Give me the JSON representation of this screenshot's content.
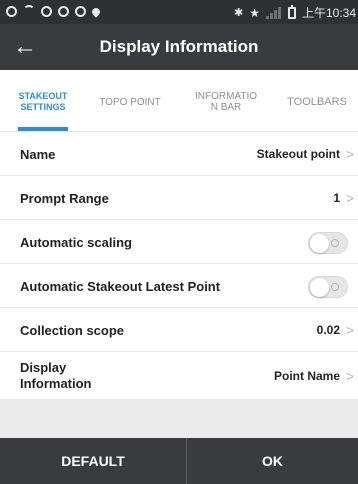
{
  "status_bar": {
    "time": "上午10:34",
    "icons": [
      "circle-icon",
      "wifi-icon",
      "circle-icon",
      "circle-icon",
      "settings-icon",
      "pin-icon",
      "bluetooth-icon",
      "star-icon",
      "signal-icon",
      "battery-icon"
    ]
  },
  "header": {
    "title": "Display Information",
    "back_icon": "arrow-left-icon"
  },
  "tabs": [
    {
      "label": "STAKEOUT\nSETTINGS",
      "active": true
    },
    {
      "label": "TOPO POINT",
      "active": false
    },
    {
      "label": "INFORMATIO\nN BAR",
      "active": false
    },
    {
      "label": "TOOLBARS",
      "active": false
    }
  ],
  "settings": {
    "name": {
      "label": "Name",
      "value": "Stakeout point"
    },
    "prompt_range": {
      "label": "Prompt Range",
      "value": "1"
    },
    "automatic_scaling": {
      "label": "Automatic scaling",
      "enabled": false
    },
    "auto_latest_point": {
      "label": "Automatic Stakeout Latest Point",
      "enabled": false
    },
    "collection_scope": {
      "label": "Collection scope",
      "value": "0.02"
    },
    "display_information": {
      "label": "Display\nInformation",
      "value": "Point Name"
    }
  },
  "buttons": {
    "default": "DEFAULT",
    "ok": "OK"
  },
  "colors": {
    "accent": "#2a8fd8",
    "app_bar": "#3a3b3f",
    "status_bar": "#2f3033",
    "background": "#ececec"
  }
}
